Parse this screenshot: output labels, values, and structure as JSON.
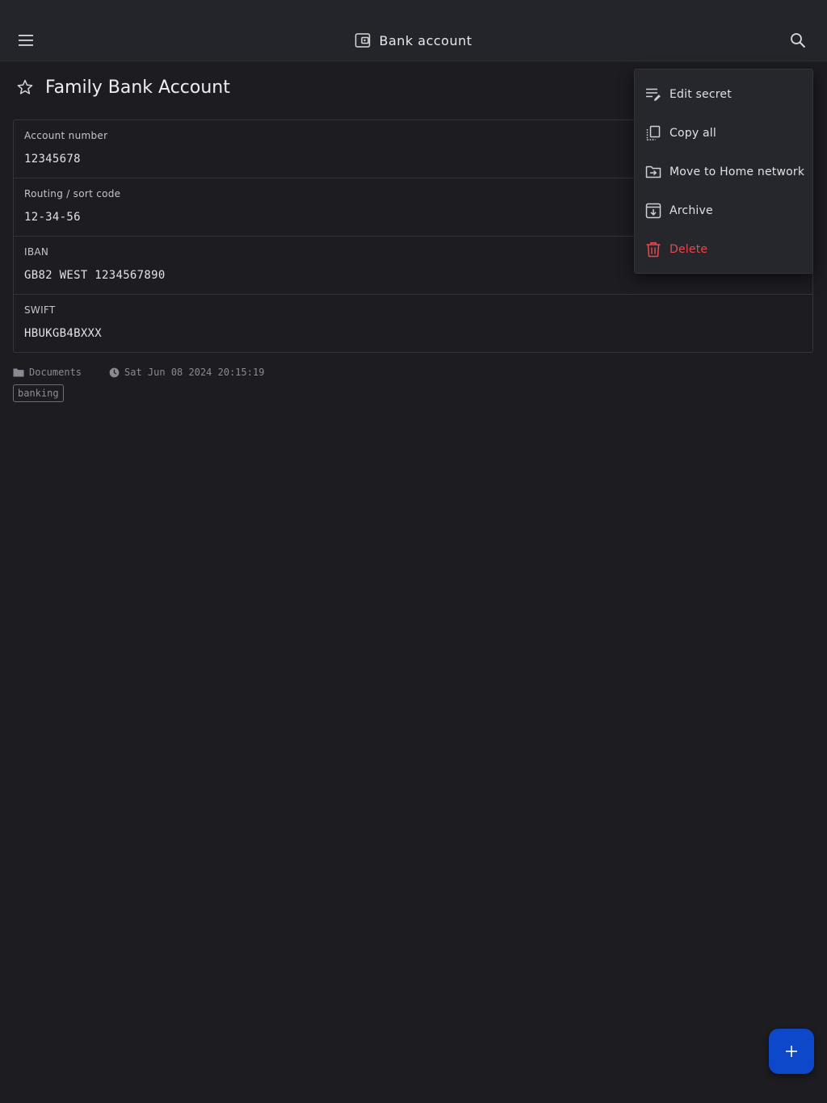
{
  "header": {
    "title": "Bank account",
    "menu_icon": "hamburger-menu-icon",
    "title_icon": "wallet-icon",
    "search_icon": "search-icon"
  },
  "secret": {
    "title": "Family Bank Account",
    "favorite_icon": "star-outline-icon",
    "fields": [
      {
        "label": "Account number",
        "value": "12345678"
      },
      {
        "label": "Routing / sort code",
        "value": "12-34-56"
      },
      {
        "label": "IBAN",
        "value": "GB82 WEST 1234567890"
      },
      {
        "label": "SWIFT",
        "value": "HBUKGB4BXXX"
      }
    ],
    "folder": "Documents",
    "modified": "Sat Jun 08 2024 20:15:19",
    "tags": [
      "banking"
    ]
  },
  "menu": {
    "items": [
      {
        "label": "Edit secret",
        "icon": "edit-note-icon"
      },
      {
        "label": "Copy all",
        "icon": "copy-icon"
      },
      {
        "label": "Move to Home network",
        "icon": "move-to-folder-icon"
      },
      {
        "label": "Archive",
        "icon": "archive-icon"
      },
      {
        "label": "Delete",
        "icon": "trash-icon"
      }
    ]
  },
  "fab": {
    "icon": "plus-icon"
  },
  "colors": {
    "background": "#1c1c21",
    "header": "#24252a",
    "danger": "#e5484d",
    "accent": "#0c48c9"
  }
}
